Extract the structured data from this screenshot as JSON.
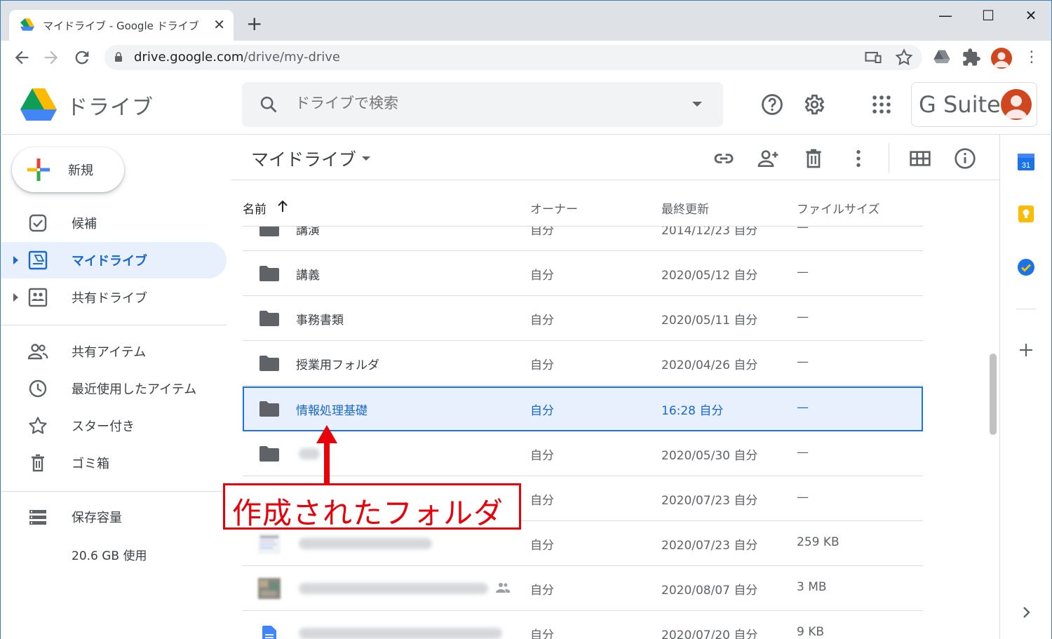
{
  "browser": {
    "tab_title": "マイドライブ - Google ドライブ",
    "tab_close": "✕",
    "new_tab": "+",
    "url_host": "drive.google.com",
    "url_path": "/drive/my-drive",
    "window_minimize": "—",
    "window_maximize": "☐",
    "window_close": "✕"
  },
  "header": {
    "app_name": "ドライブ",
    "search_placeholder": "ドライブで検索",
    "gsuite_label": "G Suite"
  },
  "sidebar": {
    "new_button": "新規",
    "items": [
      {
        "label": "候補",
        "icon": "check-box-icon"
      },
      {
        "label": "マイドライブ",
        "icon": "my-drive-icon",
        "active": true
      },
      {
        "label": "共有ドライブ",
        "icon": "shared-drive-icon"
      },
      {
        "label": "共有アイテム",
        "icon": "people-icon"
      },
      {
        "label": "最近使用したアイテム",
        "icon": "clock-icon"
      },
      {
        "label": "スター付き",
        "icon": "star-icon"
      },
      {
        "label": "ゴミ箱",
        "icon": "trash-icon"
      },
      {
        "label": "保存容量",
        "icon": "storage-icon"
      }
    ],
    "storage_used": "20.6 GB 使用"
  },
  "main": {
    "title": "マイドライブ",
    "columns": {
      "name": "名前",
      "owner": "オーナー",
      "modified": "最終更新",
      "size": "ファイルサイズ"
    },
    "rows": [
      {
        "name": "講演",
        "owner": "自分",
        "modified": "2014/12/23 自分",
        "size": "—"
      },
      {
        "name": "講義",
        "owner": "自分",
        "modified": "2020/05/12 自分",
        "size": "—"
      },
      {
        "name": "事務書類",
        "owner": "自分",
        "modified": "2020/05/11 自分",
        "size": "—"
      },
      {
        "name": "授業用フォルダ",
        "owner": "自分",
        "modified": "2020/04/26 自分",
        "size": "—"
      },
      {
        "name": "情報処理基礎",
        "owner": "自分",
        "modified": "16:28 自分",
        "size": "—",
        "selected": true
      },
      {
        "name": "",
        "owner": "自分",
        "modified": "2020/05/30 自分",
        "size": "—"
      },
      {
        "name": "",
        "owner": "自分",
        "modified": "2020/07/23 自分",
        "size": "—"
      },
      {
        "name": "",
        "owner": "自分",
        "modified": "2020/07/23 自分",
        "size": "259 KB"
      },
      {
        "name": "",
        "owner": "自分",
        "modified": "2020/08/07 自分",
        "size": "3 MB"
      },
      {
        "name": "",
        "owner": "自分",
        "modified": "2020/07/20 自分",
        "size": "9 KB"
      }
    ]
  },
  "annotation": {
    "label": "作成されたフォルダ"
  },
  "colors": {
    "accent_blue": "#1a73e8",
    "selected_bg": "#e8f0fe",
    "annotation_red": "#e8000b"
  }
}
